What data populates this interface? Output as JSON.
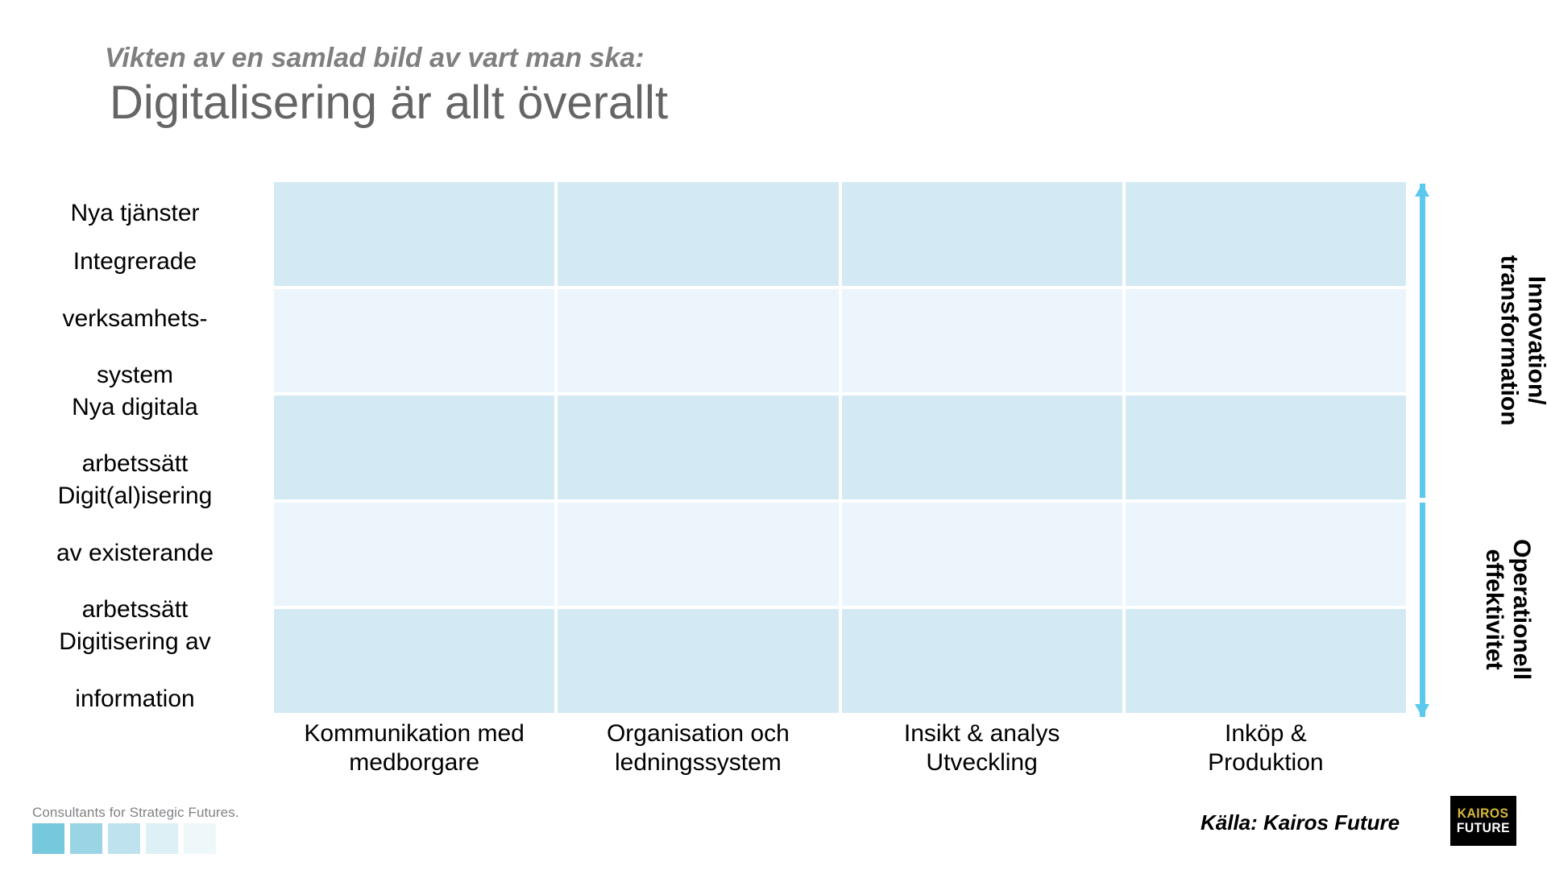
{
  "slide": {
    "kicker": "Vikten av en samlad bild av vart man ska:",
    "headline": "Digitalisering är allt överallt"
  },
  "chart_data": {
    "type": "heatmap",
    "title": "Digitalisering är allt överallt",
    "subtitle": "Vikten av en samlad bild av vart man ska:",
    "xlabel": "",
    "ylabel": "",
    "grid": true,
    "legend_position": "none",
    "categories": [
      "Kommunikation med medborgare",
      "Organisation och ledningssystem",
      "Insikt & analys Utveckling",
      "Inköp & Produktion"
    ],
    "rows": [
      "Nya tjänster",
      "Integrerade verksamhets-system",
      "Nya digitala arbetssätt",
      "Digit(al)isering av existerande arbetssätt",
      "Digitisering av information"
    ],
    "cell_colors": [
      [
        "#d3eaf5",
        "#d3eaf5",
        "#d3eaf5",
        "#d3eaf5"
      ],
      [
        "#ebf5fb",
        "#ebf5fb",
        "#ebf5fb",
        "#ebf5fb"
      ],
      [
        "#d3eaf5",
        "#d3eaf5",
        "#d3eaf5",
        "#d3eaf5"
      ],
      [
        "#ebf5fb",
        "#ebf5fb",
        "#ebf5fb",
        "#ebf5fb"
      ],
      [
        "#d3eaf5",
        "#d3eaf5",
        "#d3eaf5",
        "#d3eaf5"
      ]
    ],
    "annotations": [
      {
        "text": "Innovation/ transformation",
        "covers_rows": [
          0,
          1,
          2
        ],
        "arrow": "up"
      },
      {
        "text": "Operationell effektivitet",
        "covers_rows": [
          3,
          4
        ],
        "arrow": "down"
      }
    ]
  },
  "matrix": {
    "row_labels": [
      {
        "lines": [
          "Nya tjänster"
        ]
      },
      {
        "lines": [
          "Integrerade",
          "verksamhets-",
          "system"
        ]
      },
      {
        "lines": [
          "Nya digitala",
          "arbetssätt"
        ]
      },
      {
        "lines": [
          "Digit(al)isering",
          "av existerande",
          "arbetssätt"
        ]
      },
      {
        "lines": [
          "Digitisering av",
          "information"
        ]
      }
    ],
    "column_labels": [
      {
        "line1": "Kommunikation med",
        "line2": "medborgare"
      },
      {
        "line1": "Organisation och",
        "line2": "ledningssystem"
      },
      {
        "line1": "Insikt & analys",
        "line2": "Utveckling"
      },
      {
        "line1": "Inköp &",
        "line2": "Produktion"
      }
    ],
    "cell_color_dark": "#d3eaf5",
    "cell_color_light": "#ebf5fb"
  },
  "axes": {
    "top": {
      "line1": "Innovation/",
      "line2": "transformation",
      "arrow": "up",
      "color": "#5bc8ee"
    },
    "bottom": {
      "line1": "Operationell",
      "line2": "effektivitet",
      "arrow": "down",
      "color": "#5bc8ee"
    }
  },
  "footer": {
    "tagline": "Consultants for Strategic Futures.",
    "swatches": [
      "#76c8dd",
      "#9bd5e5",
      "#bfe3ee",
      "#dcf0f6",
      "#eef8fb"
    ],
    "source": "Källa: Kairos Future",
    "logo": {
      "line1": "KAIROS",
      "line2": "FUTURE"
    }
  }
}
